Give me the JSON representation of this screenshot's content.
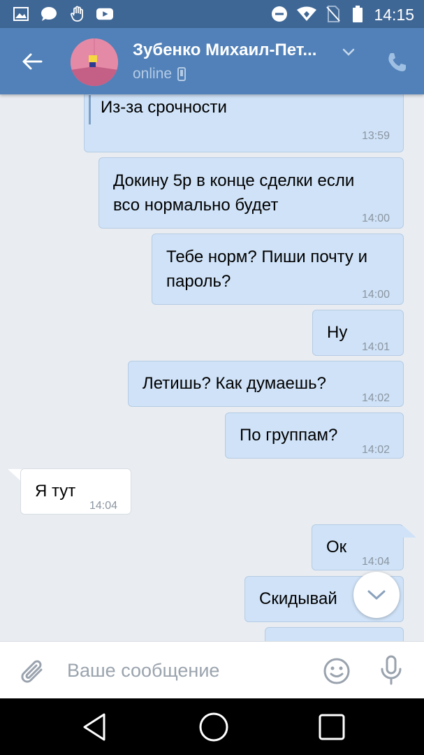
{
  "status_bar": {
    "time": "14:15",
    "left_icons": [
      "image-icon",
      "chat-icon",
      "hand-icon",
      "youtube-icon"
    ],
    "right_icons": [
      "do-not-disturb-icon",
      "wifi-icon",
      "no-sim-icon",
      "battery-icon"
    ]
  },
  "header": {
    "contact_name": "Зубенко Михаил-Пет...",
    "status": "online",
    "colors": {
      "bar": "#5181b8",
      "status_bar": "#3f6795"
    }
  },
  "messages": [
    {
      "direction": "out",
      "text": "Из-за срочности",
      "time": "13:59",
      "quoted": true
    },
    {
      "direction": "out",
      "lines": [
        "Докину 5р в конце сделки если",
        "всо нормально будет"
      ],
      "time": "14:00"
    },
    {
      "direction": "out",
      "lines": [
        "Тебе норм? Пиши почту и",
        "пароль?"
      ],
      "time": "14:00"
    },
    {
      "direction": "out",
      "text": "Ну",
      "time": "14:01"
    },
    {
      "direction": "out",
      "text": "Летишь? Как думаешь?",
      "time": "14:02"
    },
    {
      "direction": "out",
      "text": "По группам?",
      "time": "14:02"
    },
    {
      "direction": "in",
      "text": "Я тут",
      "time": "14:04"
    },
    {
      "direction": "out",
      "text": "Ок",
      "time": "14:04"
    },
    {
      "direction": "out",
      "text": "Скидывай",
      "time": ""
    }
  ],
  "composer": {
    "placeholder": "Ваше сообщение"
  },
  "colors": {
    "outgoing_bubble": "#cfe2f7",
    "incoming_bubble": "#ffffff",
    "chat_background": "#e9edf2"
  }
}
